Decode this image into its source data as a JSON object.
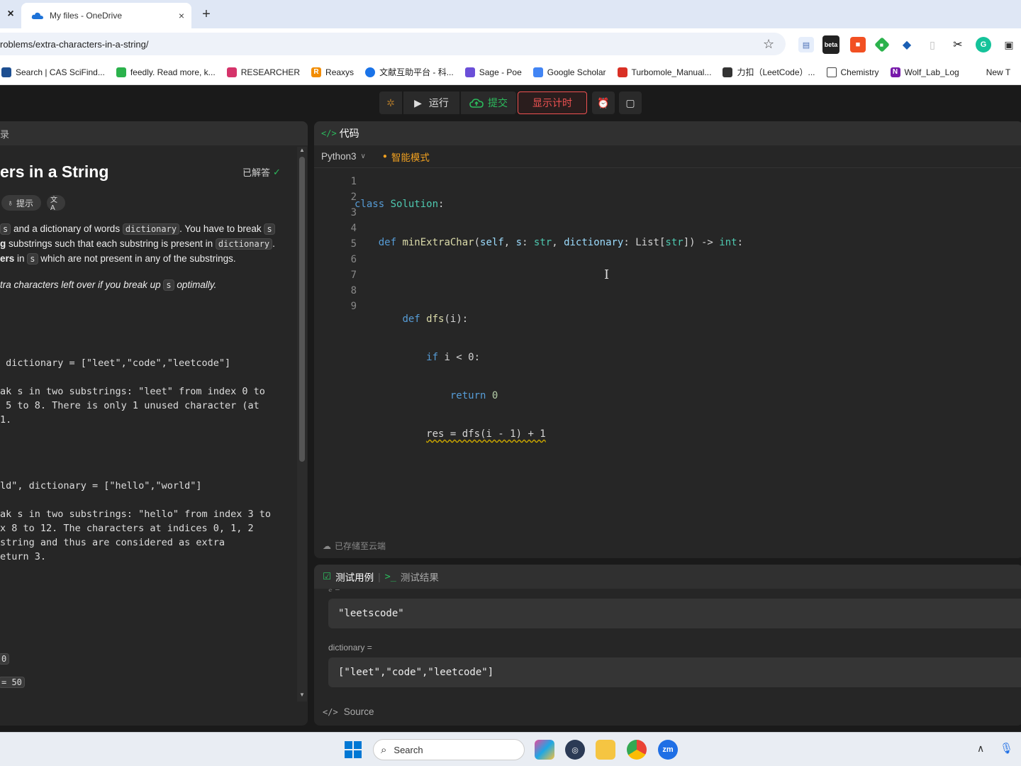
{
  "browser": {
    "tab_title": "My files - OneDrive",
    "new_tab": "+",
    "close_glyph": "×",
    "url": "roblems/extra-characters-in-a-string/",
    "bookmarks": [
      "Search | CAS SciFind...",
      "feedly. Read more, k...",
      "RESEARCHER",
      "Reaxys",
      "文献互助平台 - 科...",
      "Sage - Poe",
      "Google Scholar",
      "Turbomole_Manual...",
      "力扣（LeetCode）...",
      "Chemistry",
      "Wolf_Lab_Log",
      "New T"
    ],
    "extension_beta": "beta"
  },
  "toolbar": {
    "run_label": "运行",
    "submit_label": "提交",
    "timer_label": "显示计时"
  },
  "problem": {
    "tab_label": "录",
    "title": "ers in a String",
    "solved_label": "已解答",
    "hint_label": "提示",
    "translate_icon": "文A",
    "desc_lines": [
      {
        "pre": "",
        "code1": "s",
        "mid": " and a dictionary of words ",
        "code2": "dictionary",
        "post": ". You have to break ",
        "code3": "s"
      },
      {
        "pre": "g",
        "mid": " substrings such that each substring is present in ",
        "code2": "dictionary",
        "post": "."
      },
      {
        "pre": "ers",
        "mid": " in ",
        "code2": "s",
        "post": " which are not present in any of the substrings."
      }
    ],
    "desc_italic": {
      "pre": "tra characters left over if you break up ",
      "code": "s",
      "post": " optimally."
    },
    "example_lines": [
      " dictionary = [\"leet\",\"code\",\"leetcode\"]",
      "ak s in two substrings: \"leet\" from index 0 to",
      " 5 to 8. There is only 1 unused character (at",
      "1.",
      "ld\", dictionary = [\"hello\",\"world\"]",
      "ak s in two substrings: \"hello\" from index 3 to",
      "x 8 to 12. The characters at indices 0, 1, 2",
      "string and thus are considered as extra",
      "eturn 3."
    ],
    "constraint_1": "0",
    "constraint_2": "= 50"
  },
  "editor": {
    "panel_title": "代码",
    "language": "Python3",
    "mode": "智能模式",
    "line_numbers": [
      "1",
      "2",
      "3",
      "4",
      "5",
      "6",
      "7",
      "8",
      "9"
    ],
    "saved_label": "已存储至云端",
    "code": {
      "l1_kw": "class",
      "l1_cls": "Solution",
      "l1_end": ":",
      "l2_kw": "def",
      "l2_fn": "minExtraChar",
      "l2_open": "(",
      "l2_self": "self",
      "l2_s": "s",
      "l2_str": "str",
      "l2_dict": "dictionary",
      "l2_list": "List",
      "l2_str2": "str",
      "l2_ret": "int",
      "l4_kw": "def",
      "l4_fn": "dfs",
      "l4_rest": "(i):",
      "l5_kw": "if",
      "l5_rest": " i < 0:",
      "l6_kw": "return",
      "l6_num": "0",
      "l7": "res = dfs(i - 1) + 1"
    }
  },
  "tests": {
    "tab_cases": "测试用例",
    "tab_results": "测试结果",
    "top_stub": "s =",
    "s_value": "\"leetscode\"",
    "dict_label": "dictionary =",
    "dict_value": "[\"leet\",\"code\",\"leetcode\"]",
    "source_label": "Source"
  },
  "taskbar": {
    "search_label": "Search",
    "zoom_label": "zm"
  }
}
